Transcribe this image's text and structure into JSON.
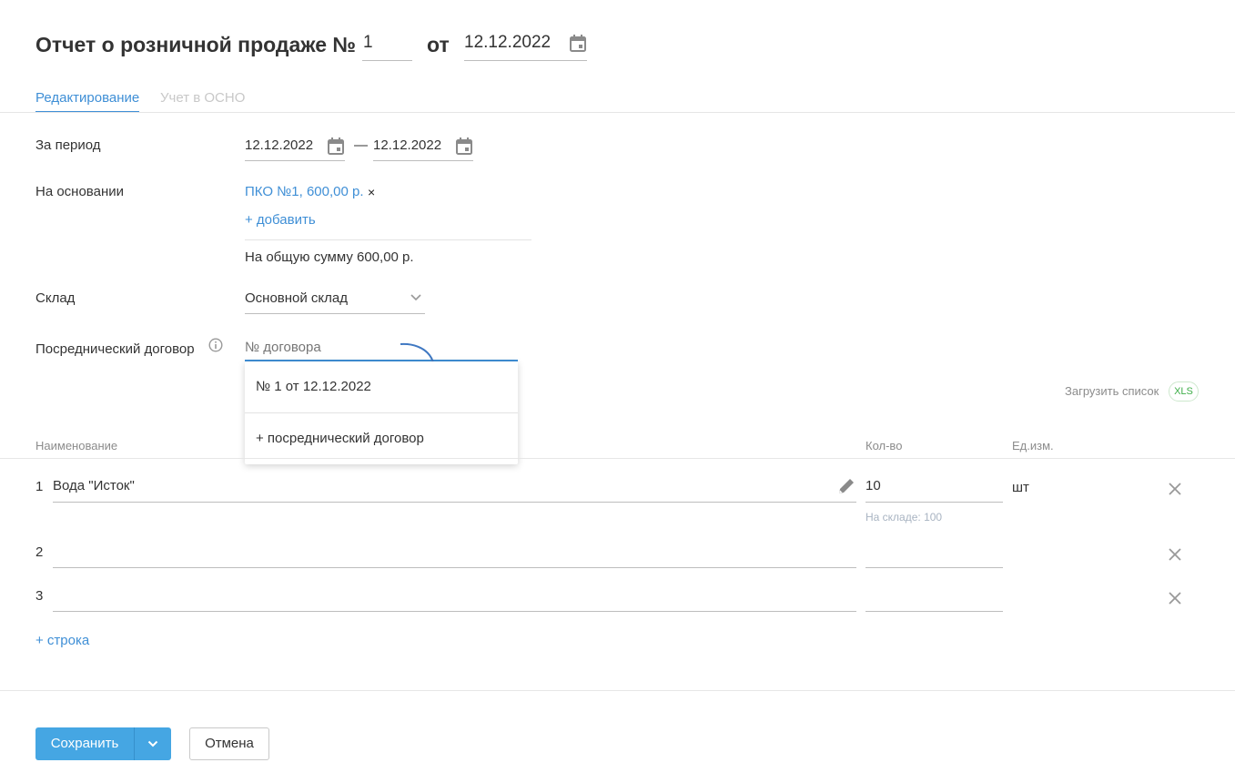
{
  "header": {
    "title": "Отчет о розничной продаже №",
    "number": "1",
    "ot": "от",
    "date": "12.12.2022"
  },
  "tabs": [
    {
      "label": "Редактирование"
    },
    {
      "label": "Учет в ОСНО"
    }
  ],
  "form": {
    "period": {
      "label": "За период",
      "from": "12.12.2022",
      "dash": "—",
      "to": "12.12.2022"
    },
    "basis": {
      "label": "На основании",
      "doc": "ПКО №1, 600,00 р.",
      "remove": "×",
      "add": "+ добавить",
      "total": "На общую сумму 600,00 р."
    },
    "warehouse": {
      "label": "Склад",
      "value": "Основной склад"
    },
    "contract": {
      "label": "Посреднический договор",
      "placeholder": "№ договора"
    }
  },
  "dropdown": {
    "options": [
      {
        "label": "№ 1 от 12.12.2022"
      },
      {
        "label": "+ посреднический договор"
      }
    ]
  },
  "upload": {
    "label": "Загрузить список",
    "badge": "XLS"
  },
  "table": {
    "headers": {
      "name": "Наименование",
      "qty": "Кол-во",
      "unit": "Ед.изм."
    },
    "rows": [
      {
        "num": "1",
        "name": "Вода \"Исток\"",
        "qty": "10",
        "unit": "шт",
        "stock": "На складе: 100"
      },
      {
        "num": "2",
        "name": "",
        "qty": "",
        "unit": "",
        "stock": ""
      },
      {
        "num": "3",
        "name": "",
        "qty": "",
        "unit": "",
        "stock": ""
      }
    ],
    "add_row": "+ строка"
  },
  "buttons": {
    "save": "Сохранить",
    "cancel": "Отмена"
  },
  "colors": {
    "accent": "#3f8fd6",
    "button": "#45a6e3",
    "badge": "#3fae49"
  }
}
